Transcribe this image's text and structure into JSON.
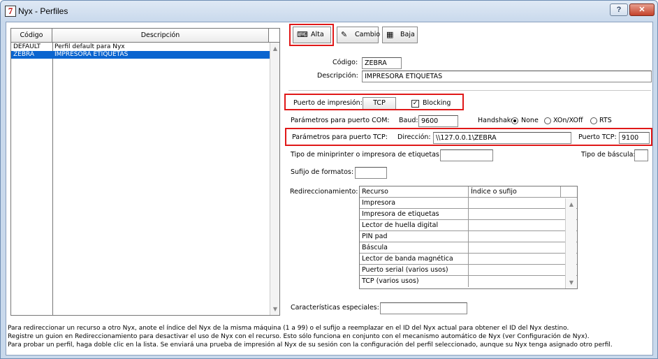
{
  "window": {
    "title": "Nyx - Perfiles",
    "app_icon_glyph": "7",
    "help_glyph": "?",
    "close_glyph": "✕"
  },
  "list": {
    "headers": {
      "code": "Código",
      "description": "Descripción"
    },
    "rows": [
      {
        "code": "DEFAULT",
        "description": "Perfil default para Nyx",
        "selected": false
      },
      {
        "code": "ZEBRA",
        "description": "IMPRESORA ETIQUETAS",
        "selected": true
      }
    ]
  },
  "toolbar": {
    "add_label": "Alta",
    "edit_label": "Cambio",
    "delete_label": "Baja"
  },
  "form": {
    "code_label": "Código:",
    "code_value": "ZEBRA",
    "description_label": "Descripción:",
    "description_value": "IMPRESORA ETIQUETAS",
    "print_port_label": "Puerto de impresión:",
    "print_port_value": "TCP",
    "blocking_label": "Blocking",
    "blocking_checked": true,
    "com_params_label": "Parámetros para puerto COM:",
    "baud_label": "Baud:",
    "baud_value": "9600",
    "handshake_label": "Handshake:",
    "handshake_options": [
      "None",
      "XOn/XOff",
      "RTS"
    ],
    "handshake_selected": "None",
    "tcp_params_label": "Parámetros para puerto TCP:",
    "address_label": "Dirección:",
    "address_value": "\\\\127.0.0.1\\ZEBRA",
    "tcp_port_label": "Puerto TCP:",
    "tcp_port_value": "9100",
    "miniprinter_label": "Tipo de miniprinter o impresora de etiquetas:",
    "miniprinter_value": "",
    "scale_type_label": "Tipo de báscula:",
    "scale_type_value": "",
    "format_suffix_label": "Sufijo de formatos:",
    "format_suffix_value": "",
    "redirection_label": "Redireccionamiento:",
    "special_features_label": "Características especiales:",
    "special_features_value": ""
  },
  "redirection_table": {
    "headers": {
      "resource": "Recurso",
      "index": "Índice o sufijo"
    },
    "rows": [
      {
        "resource": "Impresora",
        "index": ""
      },
      {
        "resource": "Impresora de etiquetas",
        "index": ""
      },
      {
        "resource": "Lector de huella digital",
        "index": ""
      },
      {
        "resource": "PIN pad",
        "index": ""
      },
      {
        "resource": "Báscula",
        "index": ""
      },
      {
        "resource": "Lector de banda magnética",
        "index": ""
      },
      {
        "resource": "Puerto serial (varios usos)",
        "index": ""
      },
      {
        "resource": "TCP (varios usos)",
        "index": ""
      }
    ]
  },
  "footer": {
    "line1": "Para redireccionar un recurso a otro Nyx, anote el índice del Nyx de la misma máquina (1 a 99) o el sufijo a reemplazar en el ID del Nyx actual para obtener el ID del Nyx destino.",
    "line2": "Registre un guion en Redireccionamiento para desactivar el uso de Nyx con el recurso. Esto sólo funciona en conjunto con el mecanismo automático de Nyx (ver Configuración de Nyx).",
    "line3": "Para probar un perfil, haga doble clic en la lista. Se enviará una prueba de impresión al Nyx de su sesión con la configuración del perfil seleccionado, aunque su Nyx tenga asignado otro perfil."
  },
  "colors": {
    "highlight": "#e01818",
    "selection": "#0a64cf"
  }
}
